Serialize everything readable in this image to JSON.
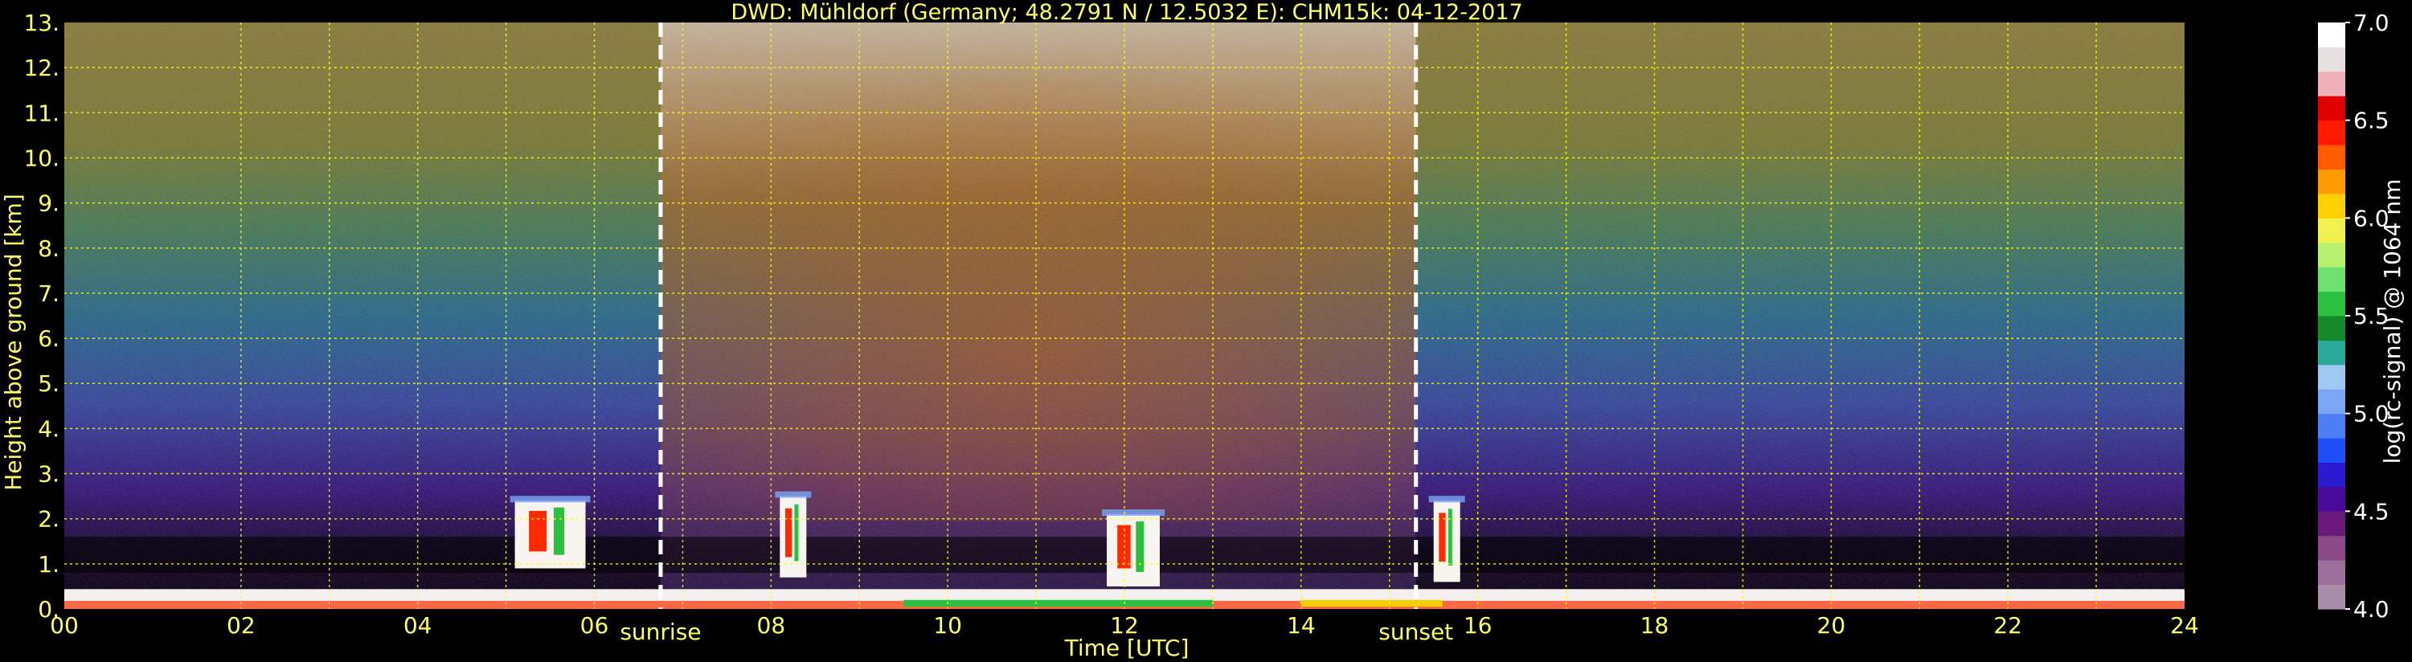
{
  "chart_data": {
    "type": "heatmap",
    "title": "DWD: Mühldorf (Germany; 48.2791 N / 12.5032 E):    CHM15k: 04-12-2017",
    "xlabel": "Time [UTC]",
    "ylabel": "Height above ground [km]",
    "xlim": [
      0,
      24
    ],
    "ylim": [
      0,
      13
    ],
    "x_ticks": [
      "00",
      "02",
      "04",
      "06",
      "08",
      "10",
      "12",
      "14",
      "16",
      "18",
      "20",
      "22",
      "24"
    ],
    "y_ticks": [
      "0.",
      "1.",
      "2.",
      "3.",
      "4.",
      "5.",
      "6.",
      "7.",
      "8.",
      "9.",
      "10.",
      "11.",
      "12.",
      "13."
    ],
    "grid": true,
    "annotations": [
      {
        "label": "sunrise",
        "x": 6.75
      },
      {
        "label": "sunset",
        "x": 15.3
      }
    ],
    "colorbar": {
      "label": "log(rc-signal) @ 1064 nm",
      "range": [
        4.0,
        7.0
      ],
      "ticks": [
        "4.0",
        "4.5",
        "5.0",
        "5.5",
        "6.0",
        "6.5",
        "7.0"
      ],
      "colors": [
        "#a88ca8",
        "#9c6f9c",
        "#8a4a8a",
        "#6a1a7a",
        "#4a0a9a",
        "#2a1ad0",
        "#1e4ef5",
        "#4d7ef5",
        "#7aa6f5",
        "#9fc8f0",
        "#2aa89a",
        "#148a2a",
        "#2cc040",
        "#6ee070",
        "#b8f070",
        "#f0f050",
        "#ffd000",
        "#ff9a00",
        "#ff5a00",
        "#ff1a00",
        "#e00000",
        "#f0b0b8",
        "#e8e0e0",
        "#ffffff"
      ]
    },
    "features": {
      "boundary_layer_top_km": 0.8,
      "clouds": [
        {
          "x_start": 5.1,
          "x_end": 5.9,
          "base_km": 0.9,
          "top_km": 2.4
        },
        {
          "x_start": 8.1,
          "x_end": 8.4,
          "base_km": 0.7,
          "top_km": 2.5
        },
        {
          "x_start": 11.8,
          "x_end": 12.4,
          "base_km": 0.5,
          "top_km": 2.1
        },
        {
          "x_start": 15.5,
          "x_end": 15.8,
          "base_km": 0.6,
          "top_km": 2.4
        }
      ]
    }
  }
}
